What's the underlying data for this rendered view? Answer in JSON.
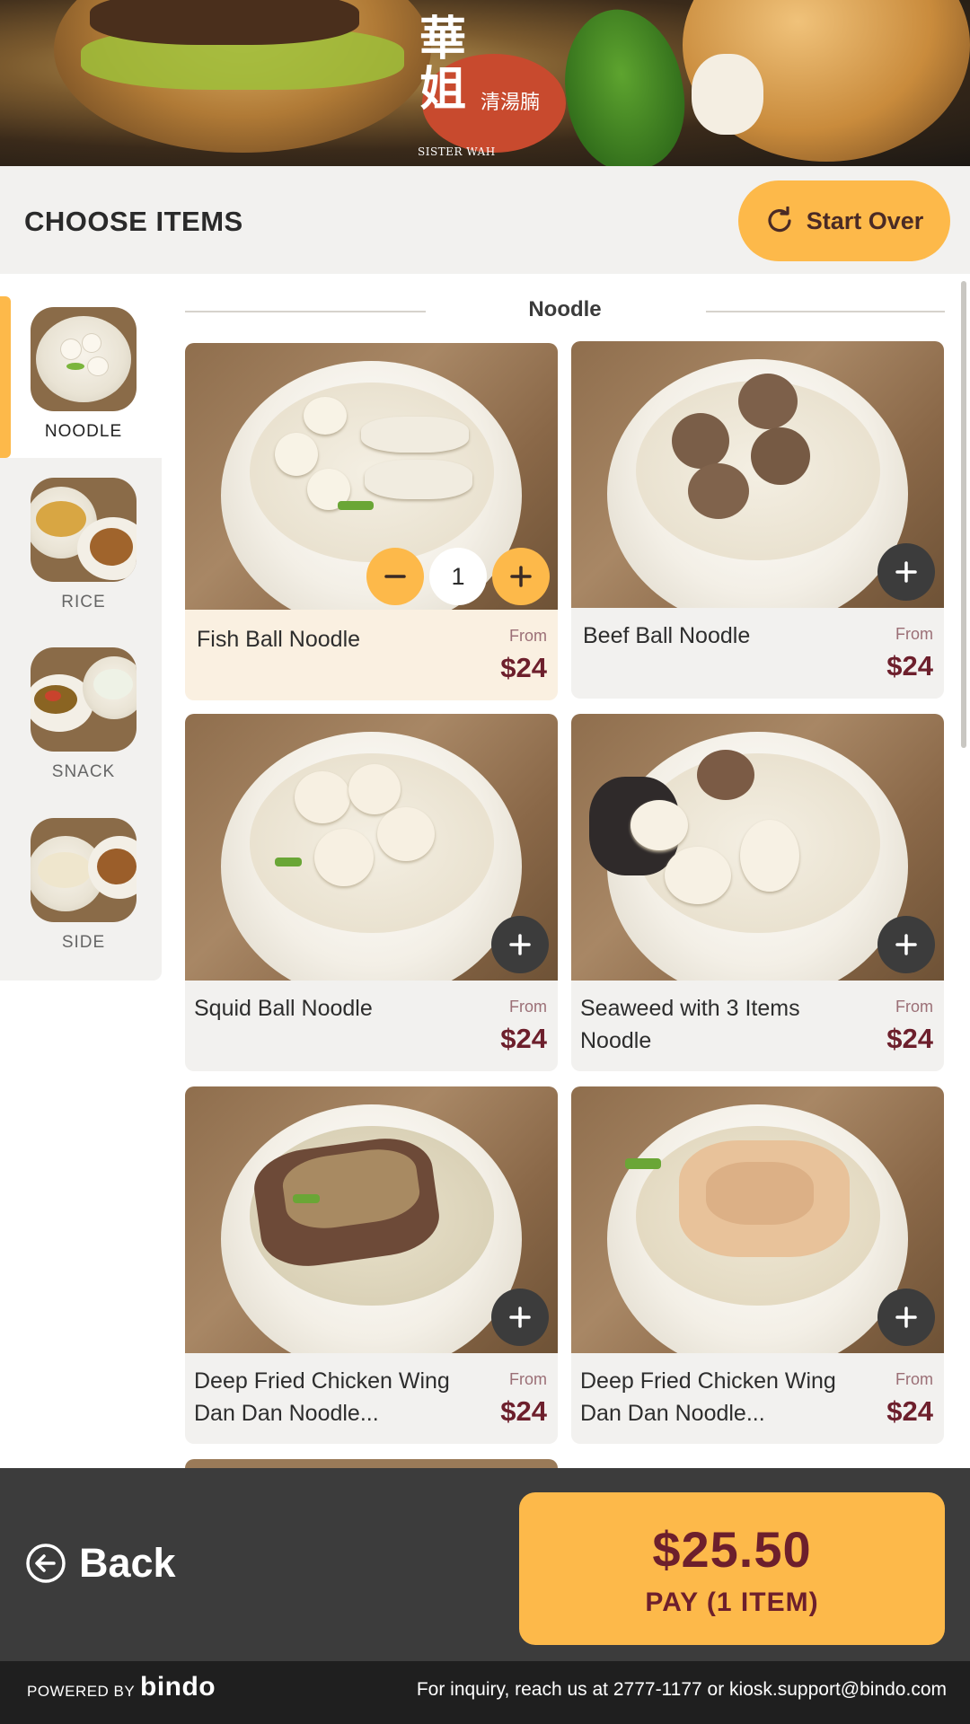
{
  "brand": {
    "logo_main_1": "華",
    "logo_main_2": "姐",
    "logo_sub": "清湯腩",
    "logo_en": "SISTER WAH"
  },
  "header": {
    "title": "CHOOSE ITEMS",
    "start_over_label": "Start Over"
  },
  "sidebar": {
    "items": [
      {
        "label": "NOODLE",
        "active": true
      },
      {
        "label": "RICE",
        "active": false
      },
      {
        "label": "SNACK",
        "active": false
      },
      {
        "label": "SIDE",
        "active": false
      }
    ]
  },
  "section": {
    "title": "Noodle"
  },
  "products": [
    {
      "name": "Fish Ball Noodle",
      "from": "From",
      "price": "$24",
      "quantity": "1",
      "selected": true
    },
    {
      "name": "Beef Ball Noodle",
      "from": "From",
      "price": "$24",
      "selected": false
    },
    {
      "name": "Squid Ball Noodle",
      "from": "From",
      "price": "$24",
      "selected": false
    },
    {
      "name": "Seaweed with 3 Items Noodle",
      "from": "From",
      "price": "$24",
      "selected": false
    },
    {
      "name": "Deep Fried Chicken Wing Dan Dan Noodle...",
      "from": "From",
      "price": "$24",
      "selected": false
    },
    {
      "name": "Deep Fried Chicken Wing Dan Dan Noodle...",
      "from": "From",
      "price": "$24",
      "selected": false
    }
  ],
  "bottom": {
    "back_label": "Back",
    "pay_amount": "$25.50",
    "pay_label": "PAY (1 ITEM)"
  },
  "footer": {
    "powered_by": "POWERED BY",
    "brand": "bindo",
    "inquiry": "For inquiry, reach us at 2777-1177 or  kiosk.support@bindo.com"
  },
  "colors": {
    "accent": "#fdb94a",
    "price": "#6d1f2c",
    "dark_bar": "#3c3c3c",
    "footer": "#1f1f1f"
  },
  "icons": {
    "start_over": "refresh-icon",
    "back": "arrow-left-circle-icon",
    "add": "plus-icon",
    "minus": "minus-icon"
  }
}
